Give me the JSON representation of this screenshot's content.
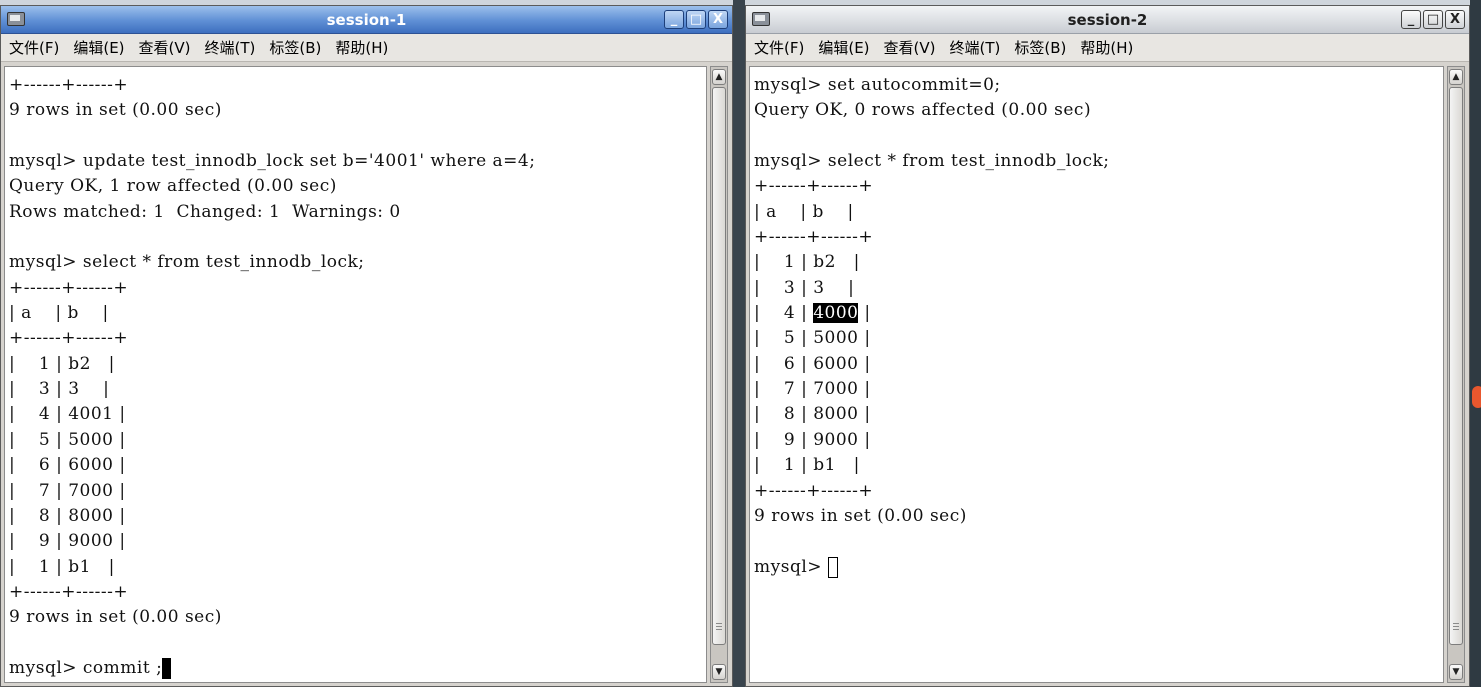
{
  "windows": [
    {
      "title": "session-1",
      "active": true,
      "menu": [
        "文件(F)",
        "编辑(E)",
        "查看(V)",
        "终端(T)",
        "标签(B)",
        "帮助(H)"
      ],
      "controls": [
        "_",
        "□",
        "X"
      ],
      "scroll_thumb_fraction": 0.97,
      "lines": [
        "+------+------+",
        "9 rows in set (0.00 sec)",
        "",
        "mysql> update test_innodb_lock set b='4001' where a=4;",
        "Query OK, 1 row affected (0.00 sec)",
        "Rows matched: 1  Changed: 1  Warnings: 0",
        "",
        "mysql> select * from test_innodb_lock;",
        "+------+------+",
        "| a    | b    |",
        "+------+------+",
        "|    1 | b2   |",
        "|    3 | 3    |",
        "|    4 | 4001 |",
        "|    5 | 5000 |",
        "|    6 | 6000 |",
        "|    7 | 7000 |",
        "|    8 | 8000 |",
        "|    9 | 9000 |",
        "|    1 | b1   |",
        "+------+------+",
        "9 rows in set (0.00 sec)",
        "",
        "mysql> commit ;"
      ],
      "cursor": {
        "line": 23,
        "style": "block"
      }
    },
    {
      "title": "session-2",
      "active": false,
      "menu": [
        "文件(F)",
        "编辑(E)",
        "查看(V)",
        "终端(T)",
        "标签(B)",
        "帮助(H)"
      ],
      "controls": [
        "_",
        "□",
        "X"
      ],
      "scroll_thumb_fraction": 0.97,
      "lines": [
        "mysql> set autocommit=0;",
        "Query OK, 0 rows affected (0.00 sec)",
        "",
        "mysql> select * from test_innodb_lock;",
        "+------+------+",
        "| a    | b    |",
        "+------+------+",
        "|    1 | b2   |",
        "|    3 | 3    |",
        "|    4 | 4000 |",
        "|    5 | 5000 |",
        "|    6 | 6000 |",
        "|    7 | 7000 |",
        "|    8 | 8000 |",
        "|    9 | 9000 |",
        "|    1 | b1   |",
        "+------+------+",
        "9 rows in set (0.00 sec)",
        "",
        "mysql> "
      ],
      "highlight": {
        "line": 9,
        "text": "4000"
      },
      "cursor": {
        "line": 19,
        "style": "hollow"
      }
    }
  ]
}
